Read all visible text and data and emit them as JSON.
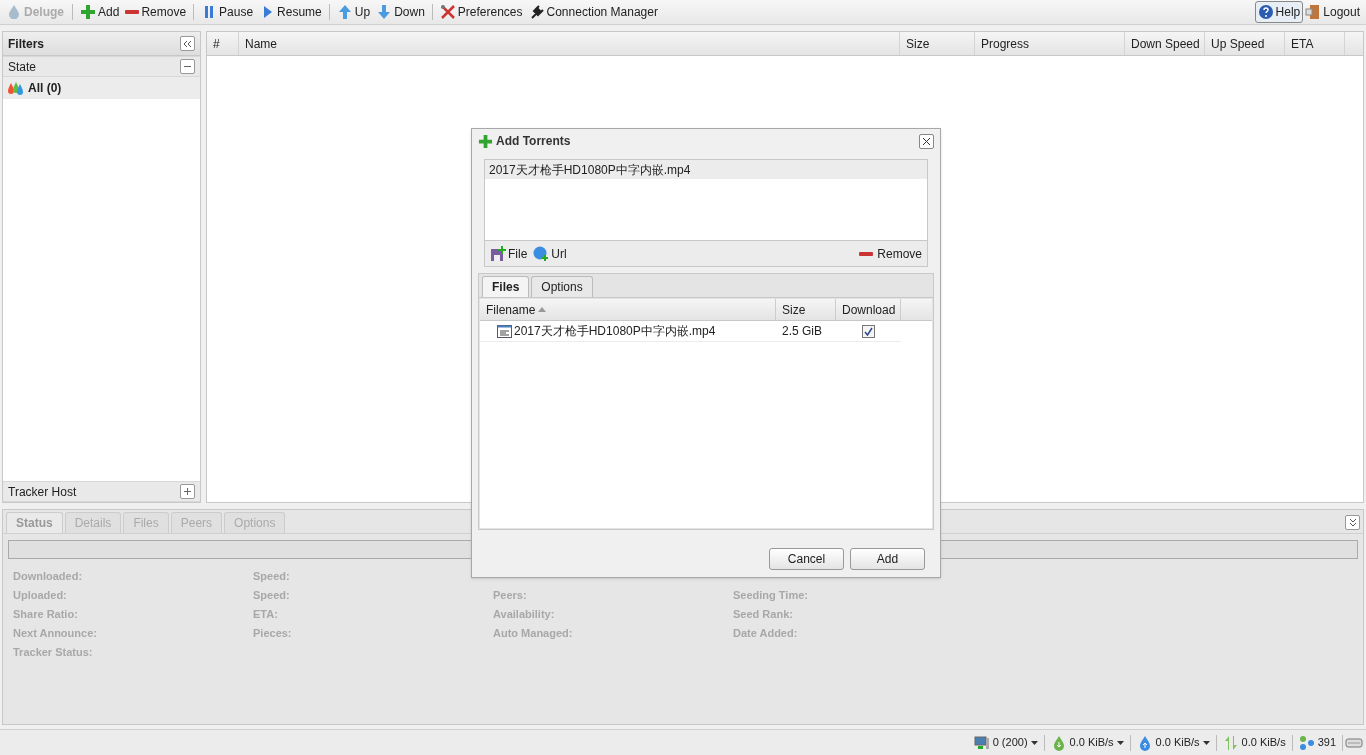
{
  "toolbar": {
    "brand": "Deluge",
    "buttons": [
      {
        "label": "Add"
      },
      {
        "label": "Remove"
      },
      {
        "label": "Pause"
      },
      {
        "label": "Resume"
      },
      {
        "label": "Up"
      },
      {
        "label": "Down"
      },
      {
        "label": "Preferences"
      },
      {
        "label": "Connection Manager"
      }
    ],
    "right_buttons": [
      {
        "label": "Help"
      },
      {
        "label": "Logout"
      }
    ]
  },
  "filters": {
    "title": "Filters",
    "sections": [
      {
        "title": "State",
        "expanded": true,
        "items": [
          {
            "label": "All (0)",
            "selected": true
          }
        ]
      },
      {
        "title": "Tracker Host",
        "expanded": false
      }
    ]
  },
  "torrent_grid": {
    "columns": [
      "#",
      "Name",
      "Size",
      "Progress",
      "Down Speed",
      "Up Speed",
      "ETA"
    ]
  },
  "details_panel": {
    "tabs": [
      {
        "label": "Status",
        "selected": true
      },
      {
        "label": "Details",
        "selected": false
      },
      {
        "label": "Files",
        "selected": false
      },
      {
        "label": "Peers",
        "selected": false
      },
      {
        "label": "Options",
        "selected": false
      }
    ],
    "progress": {
      "level": 0
    },
    "columns": [
      [
        "Downloaded:",
        "Uploaded:",
        "Share Ratio:",
        "Next Announce:",
        "Tracker Status:"
      ],
      [
        "Speed:",
        "Speed:",
        "ETA:",
        "Pieces:"
      ],
      [
        "Peers:",
        "Availability:",
        "Auto Managed:"
      ],
      [
        "Seeding Time:",
        "Seed Rank:",
        "Date Added:"
      ]
    ]
  },
  "dialog": {
    "title": "Add Torrents",
    "torrents": [
      {
        "name": "2017天才枪手HD1080P中字内嵌.mp4",
        "selected": true
      }
    ],
    "actions": [
      "File",
      "Url",
      "Remove"
    ],
    "tabs": [
      {
        "label": "Files",
        "selected": true
      },
      {
        "label": "Options",
        "selected": false
      }
    ],
    "files_table": {
      "columns": [
        "Filename",
        "Size",
        "Download"
      ],
      "rows": [
        {
          "name": "2017天才枪手HD1080P中字内嵌.mp4",
          "size": "2.5 GiB",
          "download": true
        }
      ]
    },
    "buttons": [
      "Cancel",
      "Add"
    ]
  },
  "status_bar": {
    "items": [
      {
        "text": "0 (200)",
        "dropdown": true
      },
      {
        "text": "0.0 KiB/s",
        "dropdown": true
      },
      {
        "text": "0.0 KiB/s",
        "dropdown": true
      },
      {
        "text": "0.0 KiB/s",
        "dropdown": false
      },
      {
        "text": "391",
        "dropdown": false
      }
    ]
  }
}
